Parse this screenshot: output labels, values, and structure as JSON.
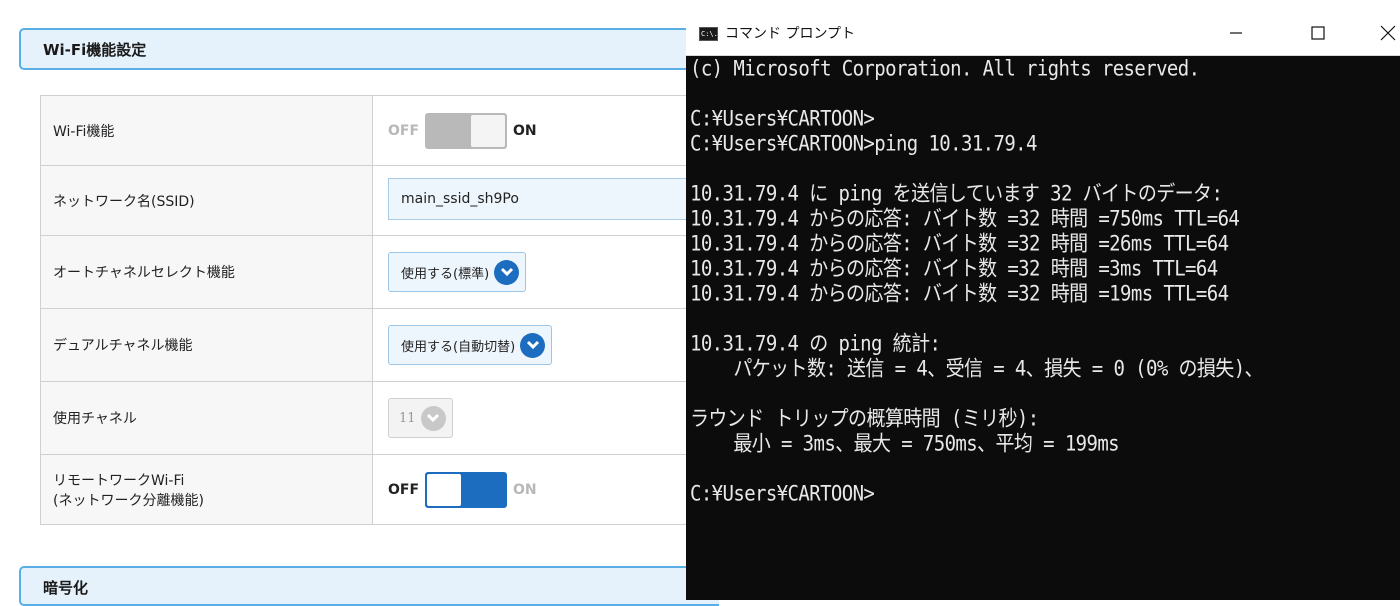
{
  "router": {
    "section1_title": "Wi-Fi機能設定",
    "section2_title": "暗号化",
    "rows": {
      "wifi": {
        "label": "Wi-Fi機能",
        "off": "OFF",
        "on": "ON"
      },
      "ssid": {
        "label": "ネットワーク名(SSID)",
        "value": "main_ssid_sh9Po"
      },
      "auto_channel": {
        "label": "オートチャネルセレクト機能",
        "value": "使用する(標準)"
      },
      "dual_channel": {
        "label": "デュアルチャネル機能",
        "value": "使用する(自動切替)"
      },
      "channel": {
        "label": "使用チャネル",
        "value": "11"
      },
      "remote": {
        "label_line1": "リモートワークWi-Fi",
        "label_line2": "(ネットワーク分離機能)",
        "off": "OFF",
        "on": "ON"
      }
    }
  },
  "cmd": {
    "title": "コマンド プロンプト",
    "icon_text": "C:\\.",
    "lines": [
      "(c) Microsoft Corporation. All rights reserved.",
      "",
      "C:¥Users¥CARTOON>",
      "C:¥Users¥CARTOON>ping 10.31.79.4",
      "",
      "10.31.79.4 に ping を送信しています 32 バイトのデータ:",
      "10.31.79.4 からの応答: バイト数 =32 時間 =750ms TTL=64",
      "10.31.79.4 からの応答: バイト数 =32 時間 =26ms TTL=64",
      "10.31.79.4 からの応答: バイト数 =32 時間 =3ms TTL=64",
      "10.31.79.4 からの応答: バイト数 =32 時間 =19ms TTL=64",
      "",
      "10.31.79.4 の ping 統計:",
      "    パケット数: 送信 = 4、受信 = 4、損失 = 0 (0% の損失)、",
      "",
      "ラウンド トリップの概算時間 (ミリ秒):",
      "    最小 = 3ms、最大 = 750ms、平均 = 199ms",
      "",
      "C:¥Users¥CARTOON>"
    ]
  }
}
